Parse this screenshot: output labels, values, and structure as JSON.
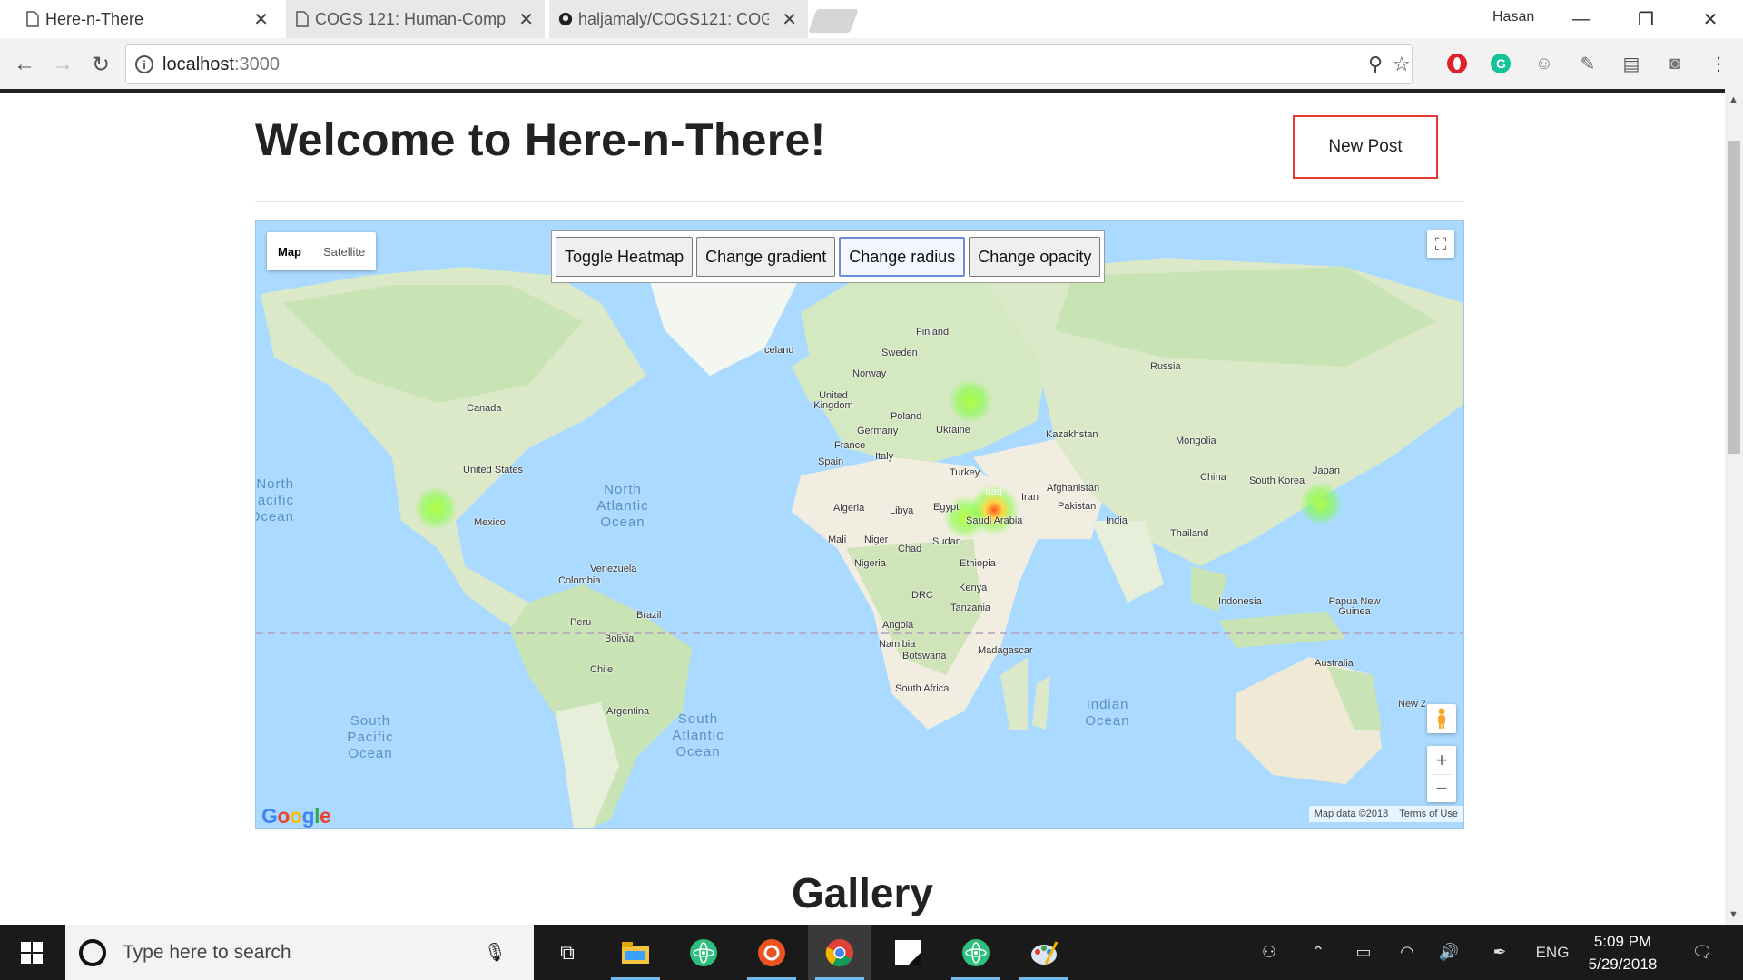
{
  "browser": {
    "tabs": [
      {
        "title": "Here-n-There",
        "active": true
      },
      {
        "title": "COGS 121: Human-Comp",
        "active": false
      },
      {
        "title": "haljamaly/COGS121: COG",
        "active": false
      }
    ],
    "profile": "Hasan",
    "url_host": "localhost",
    "url_port": ":3000"
  },
  "page": {
    "title": "Welcome to Here-n-There!",
    "new_post_label": "New Post",
    "gallery_title": "Gallery"
  },
  "map": {
    "maptype": [
      "Map",
      "Satellite"
    ],
    "controls": [
      "Toggle Heatmap",
      "Change gradient",
      "Change radius",
      "Change opacity"
    ],
    "logo": "Google",
    "attribution": "Map data ©2018",
    "terms": "Terms of Use",
    "places": [
      {
        "name": "Canada"
      },
      {
        "name": "United States"
      },
      {
        "name": "Mexico"
      },
      {
        "name": "Venezuela"
      },
      {
        "name": "Colombia"
      },
      {
        "name": "Brazil"
      },
      {
        "name": "Peru"
      },
      {
        "name": "Bolivia"
      },
      {
        "name": "Chile"
      },
      {
        "name": "Argentina"
      },
      {
        "name": "Iceland"
      },
      {
        "name": "Finland"
      },
      {
        "name": "Sweden"
      },
      {
        "name": "Norway"
      },
      {
        "name": "United Kingdom"
      },
      {
        "name": "Poland"
      },
      {
        "name": "Germany"
      },
      {
        "name": "Ukraine"
      },
      {
        "name": "France"
      },
      {
        "name": "Italy"
      },
      {
        "name": "Spain"
      },
      {
        "name": "Turkey"
      },
      {
        "name": "Iraq"
      },
      {
        "name": "Iran"
      },
      {
        "name": "Afghanistan"
      },
      {
        "name": "Pakistan"
      },
      {
        "name": "Kazakhstan"
      },
      {
        "name": "Russia"
      },
      {
        "name": "Mongolia"
      },
      {
        "name": "China"
      },
      {
        "name": "South Korea"
      },
      {
        "name": "Japan"
      },
      {
        "name": "India"
      },
      {
        "name": "Thailand"
      },
      {
        "name": "Indonesia"
      },
      {
        "name": "Papua New Guinea"
      },
      {
        "name": "Australia"
      },
      {
        "name": "Algeria"
      },
      {
        "name": "Libya"
      },
      {
        "name": "Egypt"
      },
      {
        "name": "Saudi Arabia"
      },
      {
        "name": "Mali"
      },
      {
        "name": "Niger"
      },
      {
        "name": "Chad"
      },
      {
        "name": "Sudan"
      },
      {
        "name": "Nigeria"
      },
      {
        "name": "Ethiopia"
      },
      {
        "name": "Kenya"
      },
      {
        "name": "DRC"
      },
      {
        "name": "Tanzania"
      },
      {
        "name": "Angola"
      },
      {
        "name": "Namibia"
      },
      {
        "name": "Botswana"
      },
      {
        "name": "Madagascar"
      },
      {
        "name": "South Africa"
      },
      {
        "name": "New Zeala"
      }
    ],
    "oceans": [
      {
        "name": "North Atlantic Ocean"
      },
      {
        "name": "South Atlantic Ocean"
      },
      {
        "name": "South Pacific Ocean"
      },
      {
        "name": "Indian Ocean"
      },
      {
        "name": "North Pacific Ocean"
      }
    ],
    "heat_colors": {
      "low": "#7dff3a",
      "high": "#ff4a1a"
    }
  },
  "taskbar": {
    "search_placeholder": "Type here to search",
    "language": "ENG",
    "time": "5:09 PM",
    "date": "5/29/2018"
  },
  "colors": {
    "new_post_border": "#e53935",
    "water": "#aadaff",
    "land": "#e7efda",
    "forest": "#c8e3b4",
    "desert": "#f2ede1"
  }
}
